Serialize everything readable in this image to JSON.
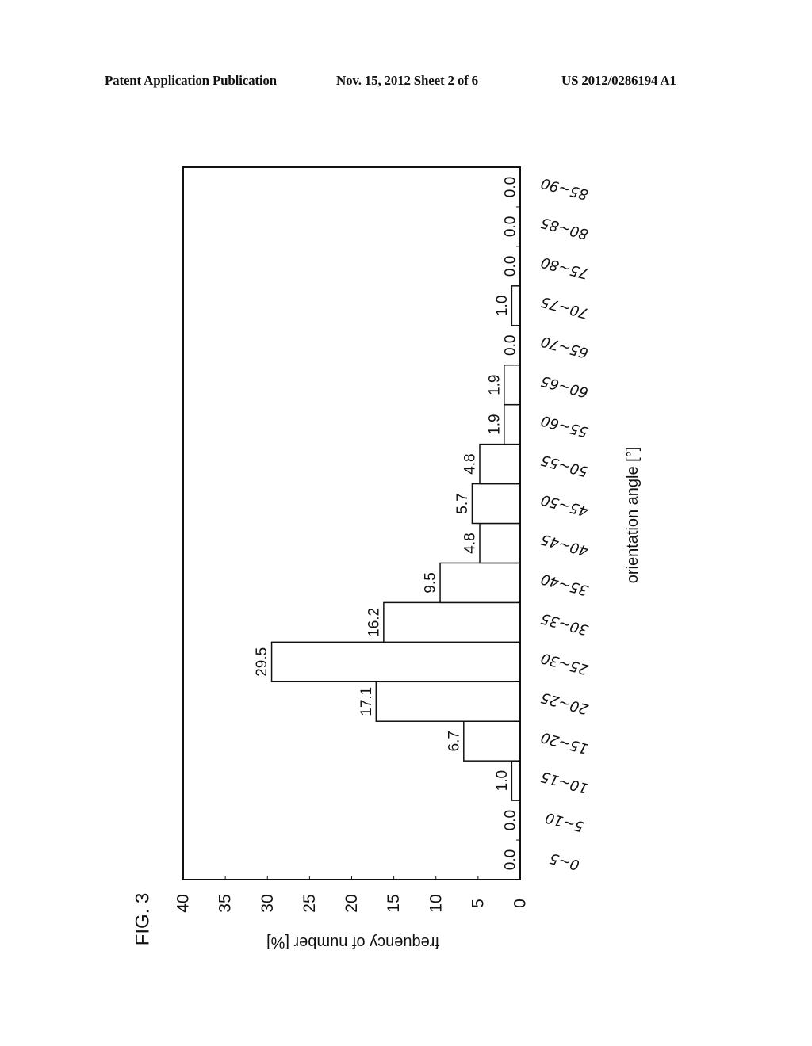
{
  "header": {
    "left": "Patent Application Publication",
    "middle": "Nov. 15, 2012   Sheet 2 of 6",
    "right": "US 2012/0286194 A1"
  },
  "figure_label": "FIG. 3",
  "chart_data": {
    "type": "bar",
    "orientation": "rotated 90° (page in landscape); bars extend horizontally",
    "title": "",
    "xlabel": "orientation angle [°]",
    "ylabel": "frequency of number [%]",
    "ylim": [
      0,
      40
    ],
    "yticks": [
      "0",
      "5",
      "10",
      "15",
      "20",
      "25",
      "30",
      "35",
      "40"
    ],
    "grid": false,
    "legend": "none",
    "categories": [
      "0~5",
      "5~10",
      "10~15",
      "15~20",
      "20~25",
      "25~30",
      "30~35",
      "35~40",
      "40~45",
      "45~50",
      "50~55",
      "55~60",
      "60~65",
      "65~70",
      "70~75",
      "75~80",
      "80~85",
      "85~90"
    ],
    "values": [
      0.0,
      0.0,
      1.0,
      6.7,
      17.1,
      29.5,
      16.2,
      9.5,
      4.8,
      5.7,
      4.8,
      1.9,
      1.9,
      0.0,
      1.0,
      0.0,
      0.0,
      0.0
    ],
    "data_labels": [
      "0.0",
      "0.0",
      "1.0",
      "6.7",
      "17.1",
      "29.5",
      "16.2",
      "9.5",
      "4.8",
      "5.7",
      "4.8",
      "1.9",
      "1.9",
      "0.0",
      "1.0",
      "0.0",
      "0.0",
      "0.0"
    ]
  }
}
